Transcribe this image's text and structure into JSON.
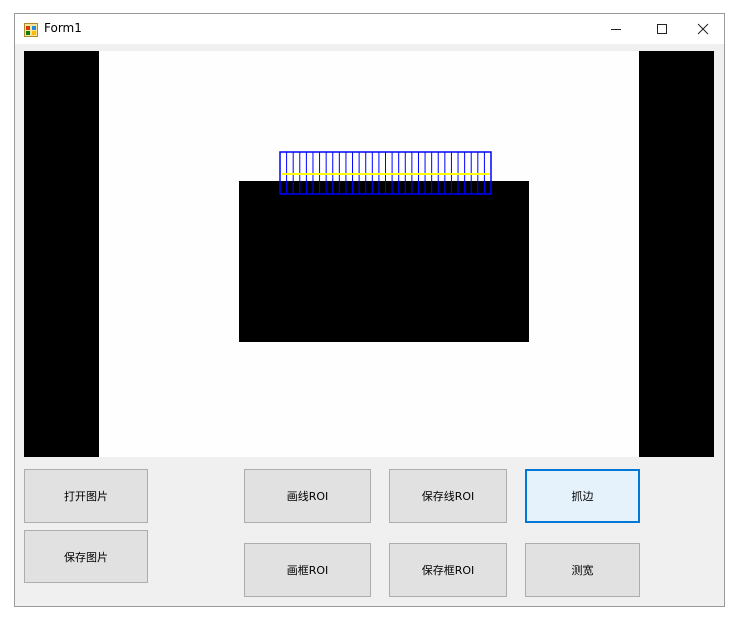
{
  "window": {
    "title": "Form1",
    "controls": {
      "minimize": "–",
      "maximize": "☐",
      "close": "✕"
    }
  },
  "picture": {
    "description_icons": [
      "image-canvas"
    ],
    "roi_caliper_count": 32,
    "colors": {
      "background": "#fefefe",
      "shape": "#000000",
      "roi_box": "#0000ff",
      "edge_line": "#ffff00"
    }
  },
  "buttons": {
    "open_image": "打开图片",
    "save_image": "保存图片",
    "draw_line_roi": "画线ROI",
    "save_line_roi": "保存线ROI",
    "grab_edge": "抓边",
    "draw_rect_roi": "画框ROI",
    "save_rect_roi": "保存框ROI",
    "measure_width": "测宽"
  },
  "colors": {
    "focus_border": "#0078d7",
    "button_bg": "#e1e1e1",
    "form_bg": "#f0f0f0"
  }
}
